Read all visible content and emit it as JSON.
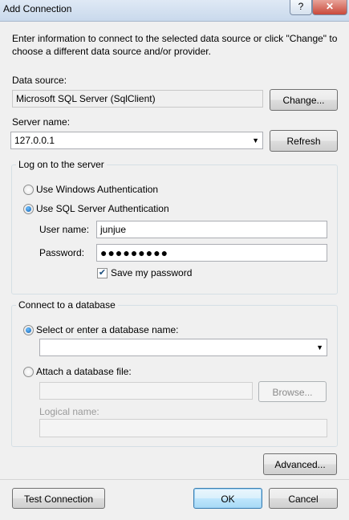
{
  "window": {
    "title": "Add Connection",
    "help_glyph": "?",
    "close_glyph": "✕"
  },
  "intro_text": "Enter information to connect to the selected data source or click \"Change\" to choose a different data source and/or provider.",
  "data_source": {
    "label": "Data source:",
    "value": "Microsoft SQL Server (SqlClient)",
    "change_button": "Change..."
  },
  "server": {
    "label": "Server name:",
    "value": "127.0.0.1",
    "refresh_button": "Refresh"
  },
  "logon": {
    "group_label": "Log on to the server",
    "windows_auth_label": "Use Windows Authentication",
    "sql_auth_label": "Use SQL Server Authentication",
    "selected": "sql",
    "username_label": "User name:",
    "username_value": "junjue",
    "password_label": "Password:",
    "password_value": "●●●●●●●●●",
    "save_password_label": "Save my password",
    "save_password_checked": true
  },
  "database": {
    "group_label": "Connect to a database",
    "select_label": "Select or enter a database name:",
    "select_value": "",
    "attach_label": "Attach a database file:",
    "attach_value": "",
    "browse_button": "Browse...",
    "logical_name_label": "Logical name:",
    "logical_name_value": "",
    "selected": "select"
  },
  "buttons": {
    "advanced": "Advanced...",
    "test_connection": "Test Connection",
    "ok": "OK",
    "cancel": "Cancel"
  }
}
